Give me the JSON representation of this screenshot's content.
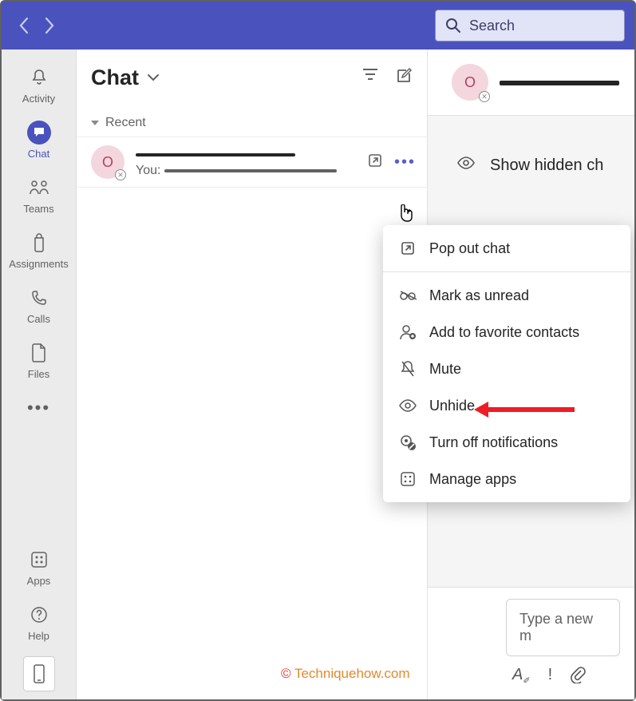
{
  "titlebar": {
    "search_placeholder": "Search"
  },
  "rail": {
    "activity": "Activity",
    "chat": "Chat",
    "teams": "Teams",
    "assignments": "Assignments",
    "calls": "Calls",
    "files": "Files",
    "apps": "Apps",
    "help": "Help"
  },
  "chatlist": {
    "title": "Chat",
    "section_recent": "Recent",
    "item": {
      "avatar_initial": "O",
      "preview_prefix": "You:"
    }
  },
  "conversation": {
    "avatar_initial": "O",
    "show_hidden_label": "Show hidden ch",
    "compose_placeholder": "Type a new m"
  },
  "context_menu": {
    "popout": "Pop out chat",
    "mark_unread": "Mark as unread",
    "add_favorite": "Add to favorite contacts",
    "mute": "Mute",
    "unhide": "Unhide",
    "turn_off_notifications": "Turn off notifications",
    "manage_apps": "Manage apps"
  },
  "watermark": {
    "copyright": "© ",
    "site": "Techniquehow.com"
  }
}
